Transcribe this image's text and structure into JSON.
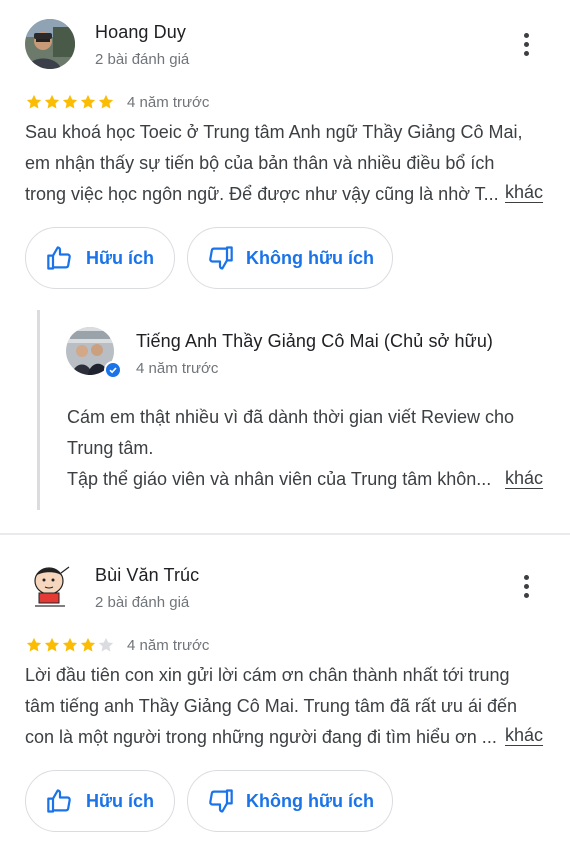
{
  "reviews": [
    {
      "author": "Hoang Duy",
      "review_count": "2 bài đánh giá",
      "rating": 5,
      "date": "4 năm trước",
      "text_lines": [
        "Sau khoá học Toeic ở Trung tâm Anh ngữ Thầy Giảng Cô Mai,",
        "em nhận thấy sự tiến bộ của bản thân và nhiều điều bổ ích",
        "trong việc học ngôn ngữ. Để được như vậy cũng là nhờ T..."
      ],
      "more_label": "khác",
      "helpful_label": "Hữu ích",
      "not_helpful_label": "Không hữu ích",
      "owner_reply": {
        "name": "Tiếng Anh Thầy Giảng Cô Mai (Chủ sở hữu)",
        "date": "4 năm trước",
        "text_lines": [
          "Cám em thật nhiều vì đã dành thời gian viết Review cho",
          "Trung tâm.",
          "Tập thể giáo viên và nhân viên của Trung tâm khôn..."
        ],
        "more_label": "khác"
      }
    },
    {
      "author": "Bùi Văn Trúc",
      "review_count": "2 bài đánh giá",
      "rating": 4,
      "date": "4 năm trước",
      "text_lines": [
        "Lời đầu tiên con xin gửi lời cám ơn chân thành nhất tới trung",
        "tâm tiếng anh Thầy Giảng Cô Mai. Trung tâm đã rất ưu ái đến",
        "con là một người trong những người đang đi tìm hiểu ơn ..."
      ],
      "more_label": "khác",
      "helpful_label": "Hữu ích",
      "not_helpful_label": "Không hữu ích"
    }
  ],
  "colors": {
    "star_filled": "#fbbc04",
    "star_empty": "#dadce0",
    "action_blue": "#1a73e8",
    "muted_text": "#70757a"
  },
  "icons": {
    "more_options": "more-vert-icon",
    "helpful": "thumb-up-icon",
    "not_helpful": "thumb-down-icon",
    "verified": "verified-check-icon",
    "star": "star-icon"
  }
}
